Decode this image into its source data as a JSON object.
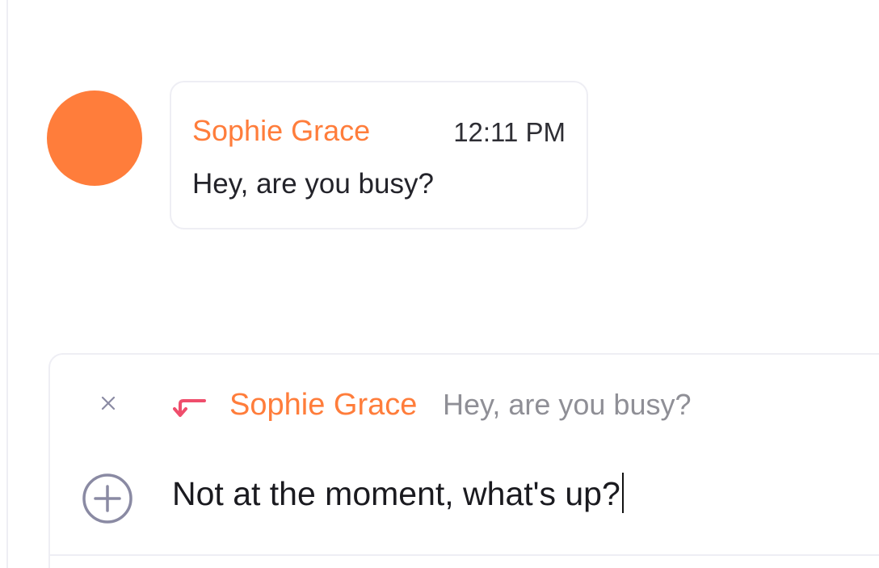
{
  "conversation": {
    "messages": [
      {
        "sender": "Sophie Grace",
        "time": "12:11 PM",
        "text": "Hey, are you busy?",
        "avatar_color": "#ff7d3b"
      }
    ]
  },
  "composer": {
    "reply_to": {
      "sender": "Sophie Grace",
      "preview": "Hey, are you busy?"
    },
    "input_value": "Not at the moment, what's up?"
  },
  "icons": {
    "close": "close-icon",
    "reply": "reply-arrow-icon",
    "add": "plus-circle-icon"
  },
  "colors": {
    "accent": "#ff7d3b",
    "reply_icon": "#ef4e6c",
    "muted_text": "#8f8f96",
    "icon_gray": "#8a8aa3",
    "border": "#eeeef4"
  }
}
